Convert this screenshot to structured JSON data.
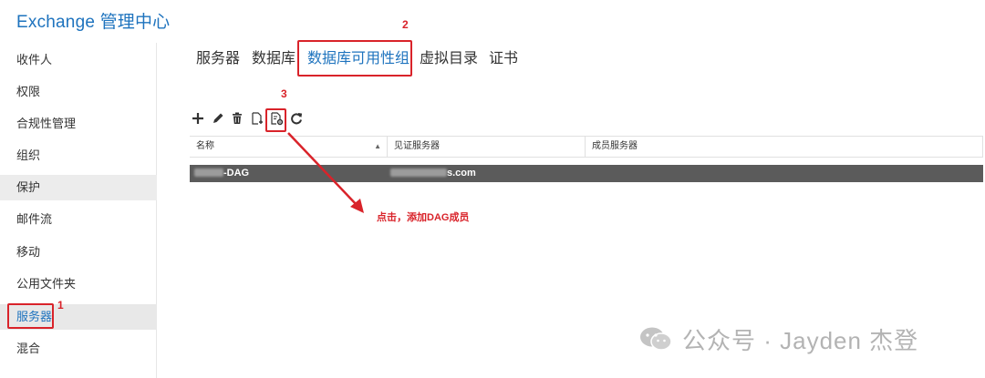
{
  "app": {
    "title": "Exchange 管理中心"
  },
  "sidebar": {
    "items": [
      {
        "label": "收件人"
      },
      {
        "label": "权限"
      },
      {
        "label": "合规性管理"
      },
      {
        "label": "组织"
      },
      {
        "label": "保护"
      },
      {
        "label": "邮件流"
      },
      {
        "label": "移动"
      },
      {
        "label": "公用文件夹"
      },
      {
        "label": "服务器",
        "selected": true
      },
      {
        "label": "混合"
      }
    ]
  },
  "tabs": [
    {
      "label": "服务器"
    },
    {
      "label": "数据库"
    },
    {
      "label": "数据库可用性组",
      "active": true
    },
    {
      "label": "虚拟目录"
    },
    {
      "label": "证书"
    }
  ],
  "toolbar": {
    "icons": [
      "add-icon",
      "edit-icon",
      "delete-icon",
      "details-icon",
      "manage-dag-membership-icon",
      "refresh-icon"
    ]
  },
  "grid": {
    "columns": [
      {
        "label": "名称",
        "sort": "▲"
      },
      {
        "label": "见证服务器"
      },
      {
        "label": "成员服务器"
      }
    ],
    "rows": [
      {
        "name_suffix": "-DAG",
        "witness_suffix": "s.com",
        "members": ""
      }
    ]
  },
  "annotations": {
    "step1": "1",
    "step2": "2",
    "step3": "3",
    "callout": "点击，添加DAG成员",
    "color": "#d9232a"
  },
  "watermark": {
    "text": "公众号 · Jayden 杰登"
  },
  "colors": {
    "accent": "#1e73be",
    "selected_row": "#5b5b5b",
    "selected_nav_bg": "#e8e8e8"
  }
}
